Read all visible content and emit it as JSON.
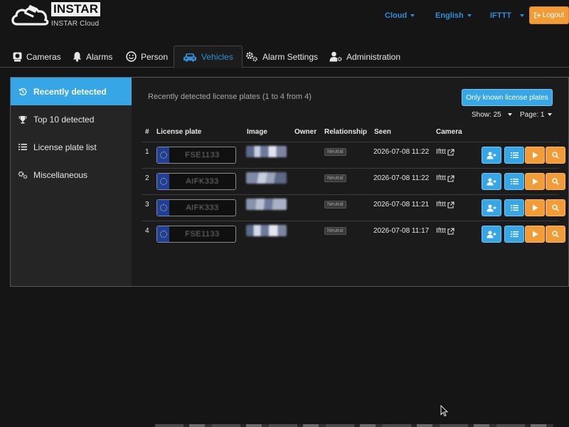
{
  "header": {
    "brand_name": "INSTAR",
    "brand_sub": "INSTAR Cloud",
    "nav": [
      "Cloud",
      "English",
      "IFTTT"
    ],
    "logout_label": "Logout"
  },
  "tabs": [
    {
      "label": "Cameras",
      "icon": "webcam-icon"
    },
    {
      "label": "Alarms",
      "icon": "bell-icon"
    },
    {
      "label": "Person",
      "icon": "smiley-icon"
    },
    {
      "label": "Vehicles",
      "icon": "car-icon",
      "active": true
    },
    {
      "label": "Alarm Settings",
      "icon": "gears-icon"
    },
    {
      "label": "Administration",
      "icon": "user-gear-icon"
    }
  ],
  "sidebar": {
    "items": [
      {
        "label": "Recently detected",
        "icon": "history-icon",
        "active": true
      },
      {
        "label": "Top 10 detected",
        "icon": "trophy-icon"
      },
      {
        "label": "License plate list",
        "icon": "list-icon"
      },
      {
        "label": "Miscellaneous",
        "icon": "gears-icon"
      }
    ]
  },
  "main": {
    "title": "Recently detected license plates (1 to 4 from 4)",
    "known_button": "Only known license plates",
    "show_label": "Show: 25",
    "page_label": "Page: 1"
  },
  "table": {
    "headers": [
      "#",
      "License plate",
      "Image",
      "Owner",
      "Relationship",
      "Seen",
      "Camera"
    ],
    "rows": [
      {
        "num": "1",
        "plate": "FSE1133",
        "owner": "",
        "relationship": "Neutral",
        "seen": "2026-07-08 11:22",
        "camera": "Ifttt"
      },
      {
        "num": "2",
        "plate": "AIFK333",
        "owner": "",
        "relationship": "Neutral",
        "seen": "2026-07-08 11:22",
        "camera": "Ifttt"
      },
      {
        "num": "3",
        "plate": "AIFK333",
        "owner": "",
        "relationship": "Neutral",
        "seen": "2026-07-08 11:21",
        "camera": "Ifttt"
      },
      {
        "num": "4",
        "plate": "FSE1133",
        "owner": "",
        "relationship": "Neutral",
        "seen": "2026-07-08 11:17",
        "camera": "Ifttt"
      }
    ]
  },
  "colors": {
    "accent_blue": "#37a6e6",
    "link_blue": "#2f8fd6",
    "action_orange": "#f29c38",
    "background": "#151515"
  }
}
